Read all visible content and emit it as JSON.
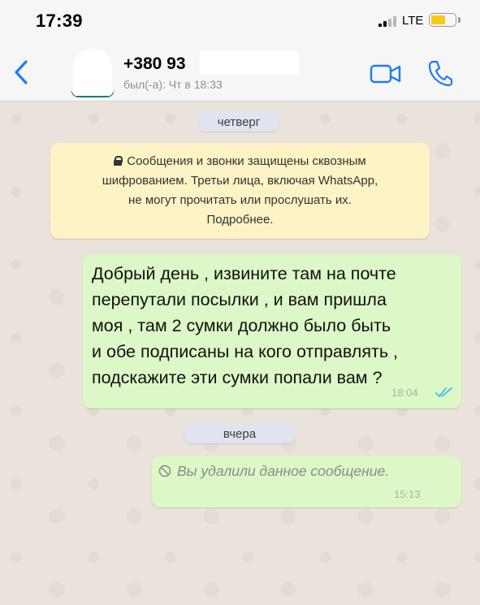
{
  "status_bar": {
    "time": "17:39",
    "network": "LTE",
    "battery_level": 0.6,
    "battery_color": "#f6cc13"
  },
  "header": {
    "back_icon": "chevron-left-icon",
    "contact_name": "+380 93",
    "contact_status": "был(-а): Чт в 18:33",
    "video_icon": "video-camera-icon",
    "call_icon": "phone-icon",
    "accent_color": "#1f7bf6"
  },
  "chat": {
    "date_thursday": "четверг",
    "encryption_notice": {
      "icon": "lock-icon",
      "line1": "Сообщения и звонки защищены сквозным",
      "line2": "шифрованием. Третьи лица, включая WhatsApp,",
      "line3": "не могут прочитать или прослушать их.",
      "line4": "Подробнее."
    },
    "messages": [
      {
        "direction": "outgoing",
        "lines": [
          "Добрый день , извините там на почте",
          "перепутали посылки , и вам пришла",
          "моя , там 2 сумки должно было быть",
          "и обе подписаны на кого отправлять ,",
          "подскажите эти сумки попали вам ?"
        ],
        "time": "18:04",
        "status_icon": "double-check-icon",
        "status_color": "#34b7f1"
      },
      {
        "direction": "outgoing",
        "deleted": true,
        "icon": "prohibited-icon",
        "text": "Вы удалили данное сообщение.",
        "time": "15:13"
      }
    ],
    "date_yesterday": "вчера",
    "bubble_color": "#dcf8c6",
    "notice_color": "#fdf3c4"
  }
}
